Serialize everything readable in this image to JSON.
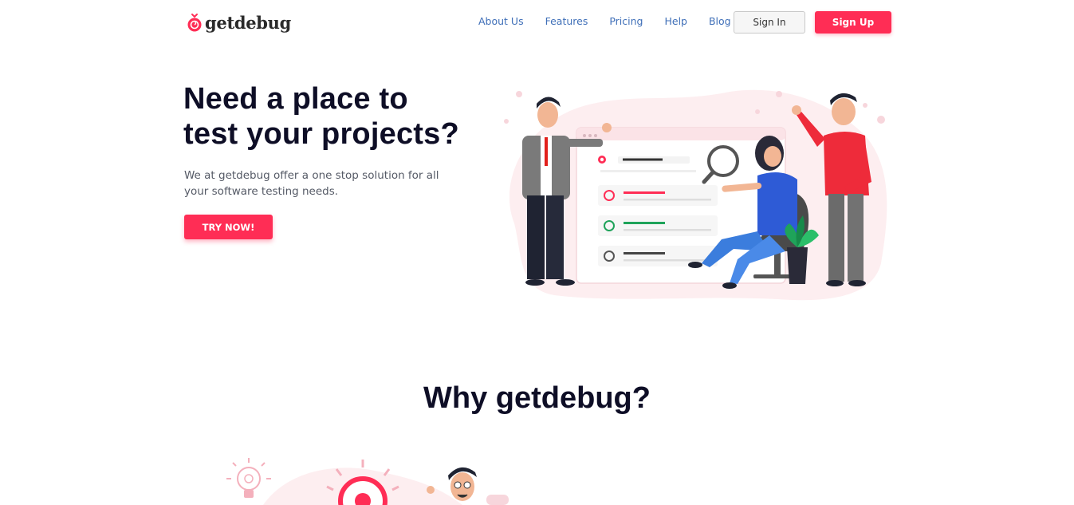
{
  "brand": {
    "name": "getdebug"
  },
  "nav": {
    "items": [
      "About Us",
      "Features",
      "Pricing",
      "Help",
      "Blog"
    ],
    "sign_in": "Sign In",
    "sign_up": "Sign Up"
  },
  "hero": {
    "title_line1": "Need a place to",
    "title_line2": "test your projects?",
    "subtitle": "We at getdebug offer a one stop solution for all your software testing needs.",
    "cta": "TRY NOW!"
  },
  "why": {
    "title": "Why getdebug?"
  },
  "colors": {
    "accent": "#ff2d55",
    "nav_link": "#3f6fb8",
    "heading": "#0e0e26"
  },
  "icons": [
    "logo-bug-icon",
    "magnifier-icon",
    "bug-icon",
    "lightbulb-icon"
  ]
}
